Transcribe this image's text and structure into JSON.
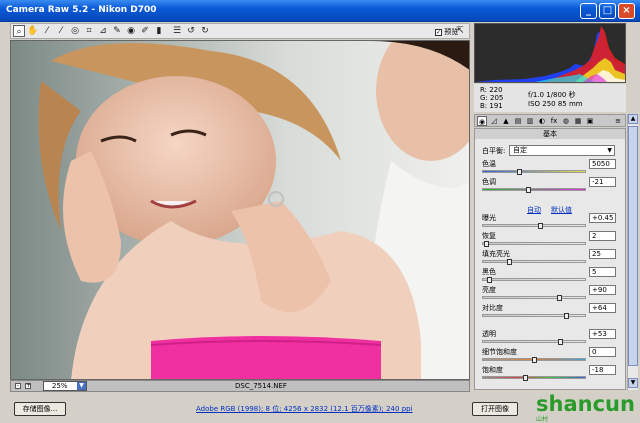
{
  "window": {
    "title": "Camera Raw 5.2 - Nikon D700"
  },
  "toolbar": {
    "tools": [
      "zoom-icon",
      "hand-icon",
      "eyedropper-icon",
      "color-sampler-icon",
      "target-adjust-icon",
      "crop-icon",
      "straighten-icon",
      "spot-removal-icon",
      "red-eye-icon",
      "adjustment-brush-icon",
      "gradient-icon",
      "list-icon",
      "rotate-ccw-icon",
      "rotate-cw-icon"
    ],
    "preview_label": "预览"
  },
  "canvas": {
    "filename": "DSC_7514.NEF",
    "zoom": "25%"
  },
  "histogram": {
    "colors": {
      "red": "#e02020",
      "yellow": "#f0e020",
      "blue": "#2040f0",
      "cyan": "#20e0f0",
      "magenta": "#e020e0",
      "white": "#ffffff"
    }
  },
  "exif": {
    "r": "R:  220",
    "g": "G:  205",
    "b": "B:  191",
    "aperture_shutter": "f/1.0  1/800 秒",
    "iso_focal": "ISO 250  85 mm"
  },
  "panel": {
    "title": "基本",
    "white_balance_label": "白平衡:",
    "white_balance_value": "自定",
    "auto_link": "自动",
    "default_link": "默认值",
    "sliders": [
      {
        "label": "色温",
        "value": "5050",
        "pos": 0.35,
        "track": "temp"
      },
      {
        "label": "色调",
        "value": "-21",
        "pos": 0.44,
        "track": "tint"
      },
      {
        "label": "曝光",
        "value": "+0.45",
        "pos": 0.56,
        "track": "gray"
      },
      {
        "label": "恢复",
        "value": "2",
        "pos": 0.02,
        "track": "gray"
      },
      {
        "label": "填充亮光",
        "value": "25",
        "pos": 0.25,
        "track": "gray"
      },
      {
        "label": "黑色",
        "value": "5",
        "pos": 0.05,
        "track": "gray"
      },
      {
        "label": "亮度",
        "value": "+90",
        "pos": 0.75,
        "track": "gray"
      },
      {
        "label": "对比度",
        "value": "+64",
        "pos": 0.82,
        "track": "gray"
      },
      {
        "label": "透明",
        "value": "+53",
        "pos": 0.76,
        "track": "gray"
      },
      {
        "label": "细节饱和度",
        "value": "0",
        "pos": 0.5,
        "track": "vib"
      },
      {
        "label": "饱和度",
        "value": "-18",
        "pos": 0.41,
        "track": "sat"
      }
    ]
  },
  "bottom": {
    "save_button": "存储图像...",
    "info_link": "Adobe RGB (1998); 8 位; 4256 x 2832 (12.1 百万像素); 240 ppi",
    "open_button": "打开图像"
  },
  "watermark": {
    "text": "shancun",
    "site": "山村"
  }
}
